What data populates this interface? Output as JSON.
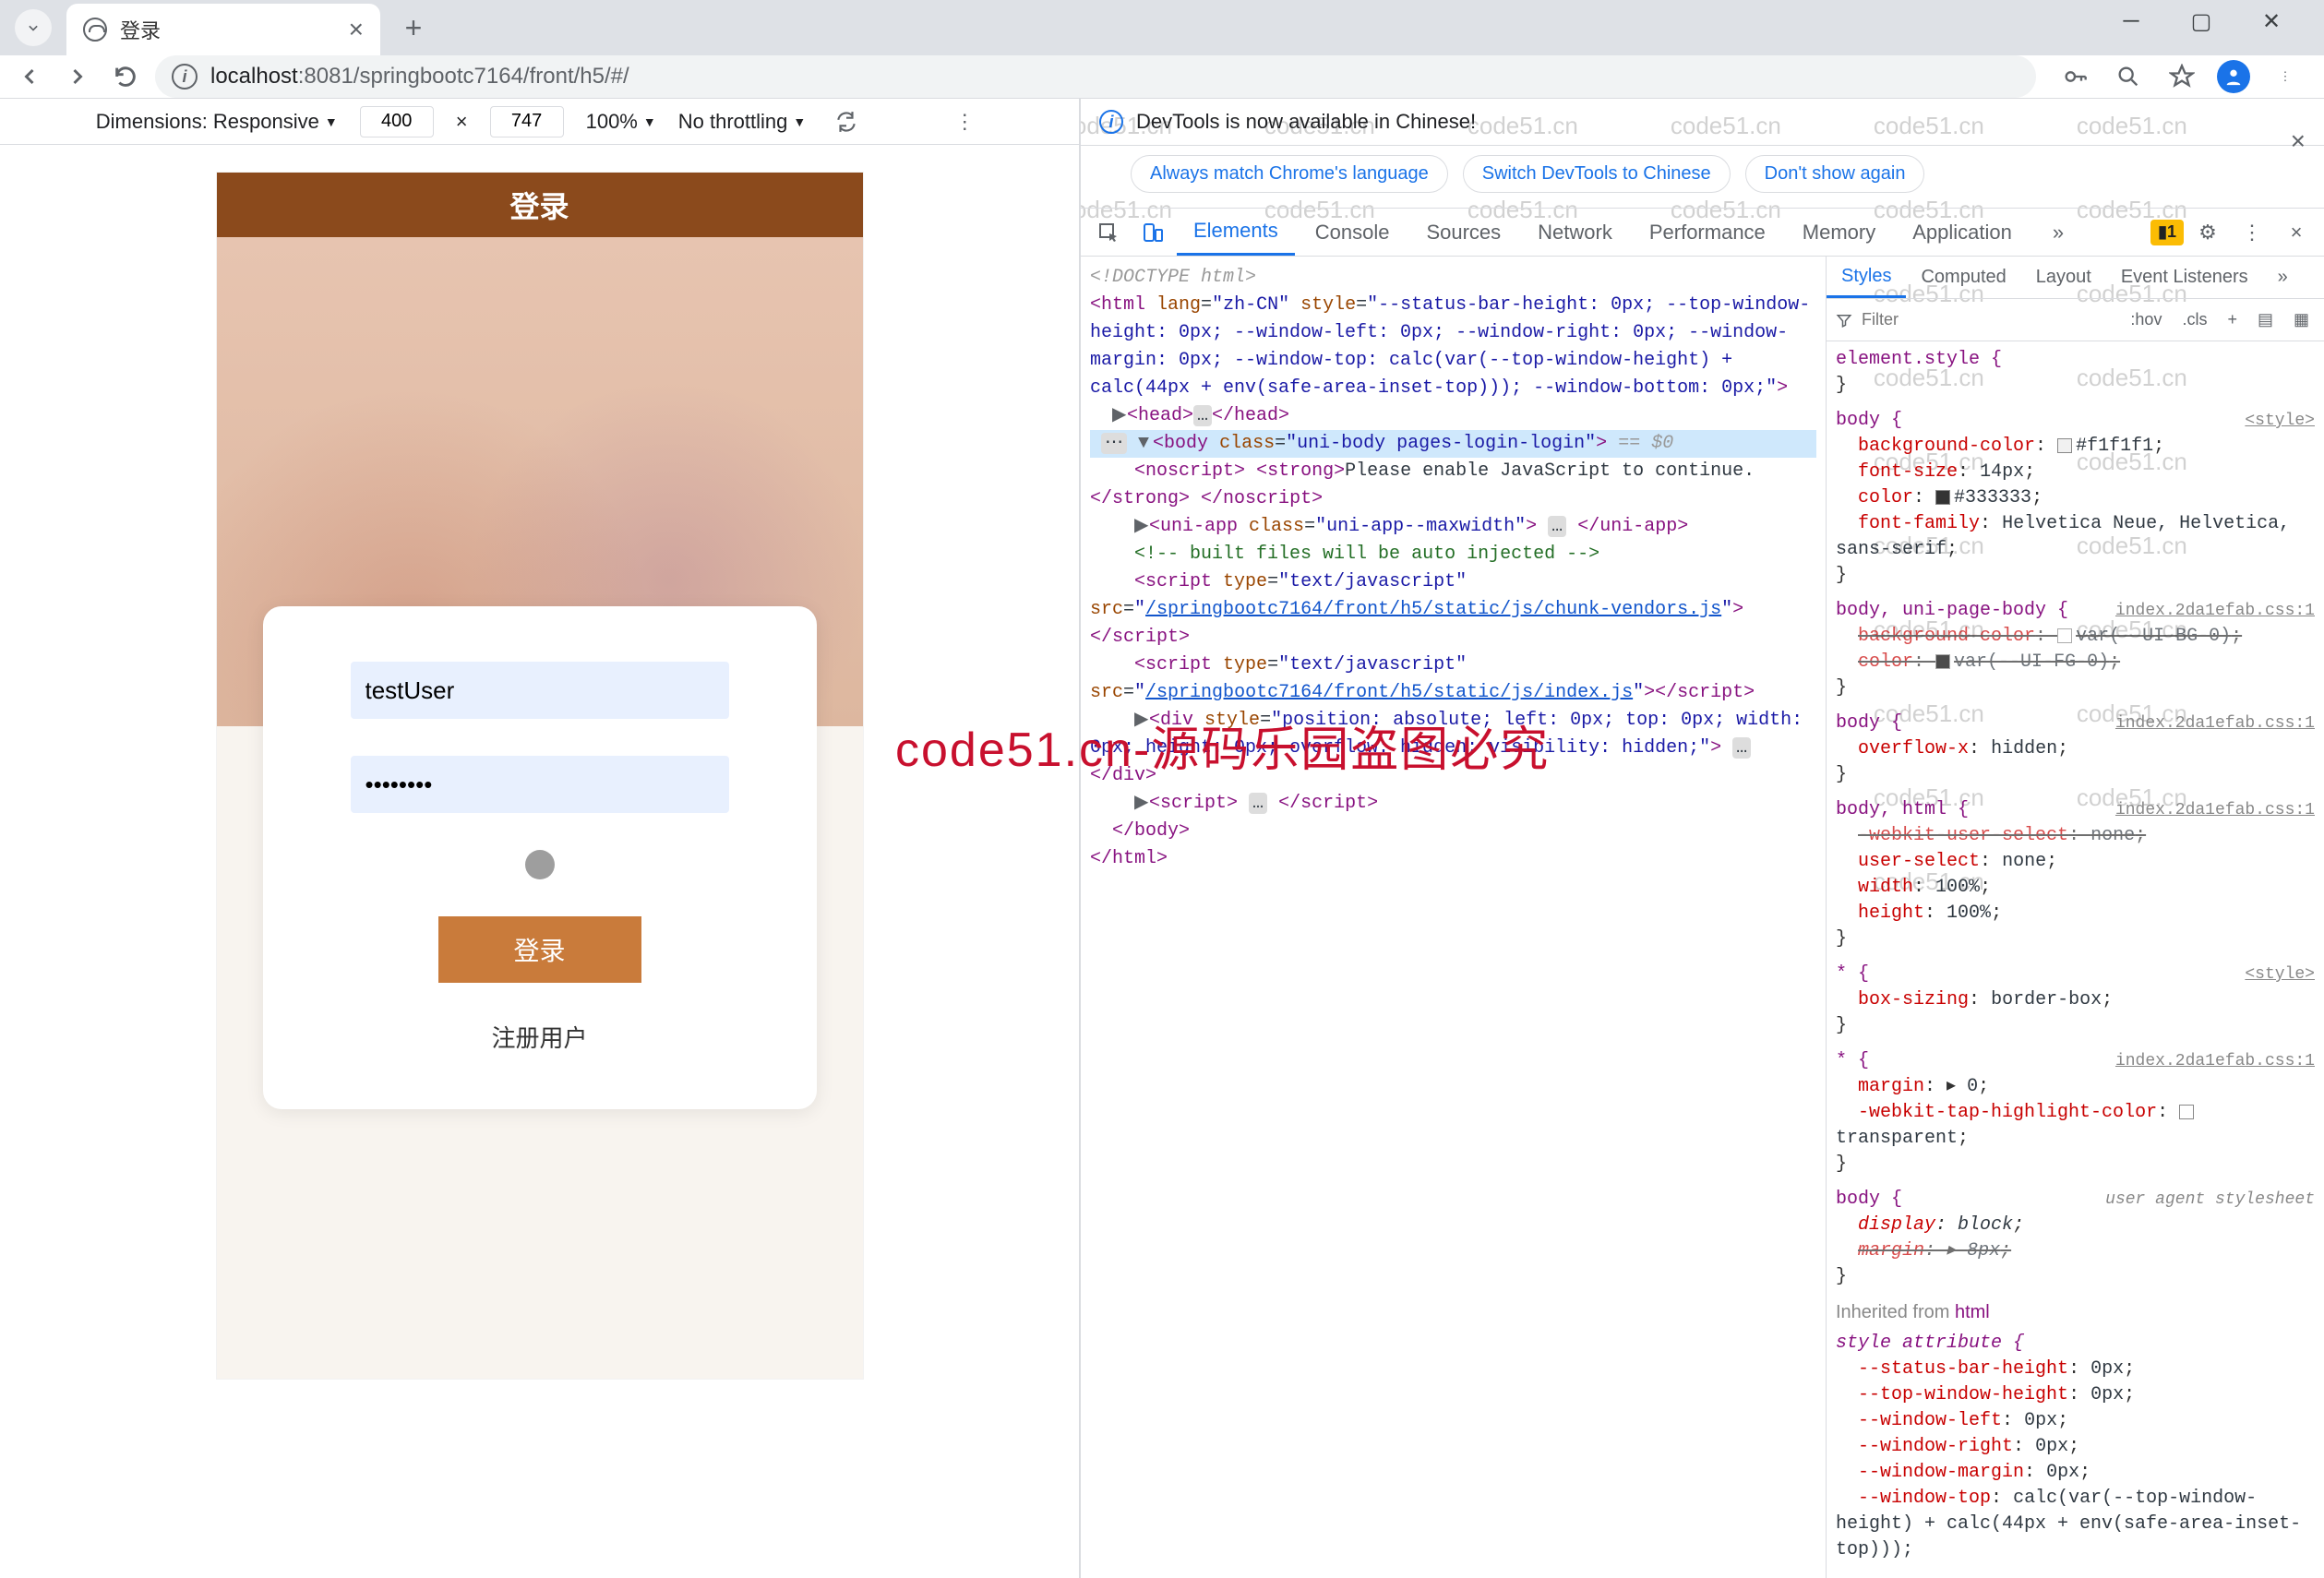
{
  "tab": {
    "title": "登录"
  },
  "addr": {
    "host": "localhost",
    "port": ":8081",
    "path": "/springbootc7164/front/h5/#/"
  },
  "deviceToolbar": {
    "dimensionsLabel": "Dimensions: Responsive",
    "width": "400",
    "x": "×",
    "height": "747",
    "zoom": "100%",
    "throttling": "No throttling"
  },
  "app": {
    "headerTitle": "登录",
    "username": "testUser",
    "password": "••••••••",
    "loginBtn": "登录",
    "registerLink": "注册用户"
  },
  "devtools": {
    "bannerText": "DevTools is now available in Chinese!",
    "pill1": "Always match Chrome's language",
    "pill2": "Switch DevTools to Chinese",
    "pill3": "Don't show again",
    "tabs": {
      "elements": "Elements",
      "console": "Console",
      "sources": "Sources",
      "network": "Network",
      "performance": "Performance",
      "memory": "Memory",
      "application": "Application"
    },
    "warnCount": "1"
  },
  "tree": {
    "doctype": "<!DOCTYPE html>",
    "htmlOpen": "<html lang=\"zh-CN\" style=\"--status-bar-height: 0px; --top-window-height: 0px; --window-left: 0px; --window-right: 0px; --window-margin: 0px; --window-top: calc(var(--top-window-height) + calc(44px + env(safe-area-inset-top))); --window-bottom: 0px;\">",
    "headLine": "<head>…</head>",
    "bodyOpen": "<body class=\"uni-body pages-login-login\"> == $0",
    "noscript1": "<noscript> <strong>Please enable JavaScript to continue.</strong> </noscript>",
    "uniapp": "<uni-app class=\"uni-app--maxwidth\"> … </uni-app>",
    "comment": "<!-- built files will be auto injected -->",
    "script1a": "<script type=\"text/javascript\" src=\"",
    "script1link": "/springbootc7164/front/h5/static/js/chunk-vendors.js",
    "script1b": "\"></​script>",
    "script2a": "<script type=\"text/javascript\" src=\"",
    "script2link": "/springbootc7164/front/h5/static/js/index.js",
    "script2b": "\"></​script>",
    "divLine": "<div style=\"position: absolute; left: 0px; top: 0px; width: 0px; height: 0px; overflow: hidden; visibility: hidden;\"> … </div>",
    "scriptGeneric": "<script> … </​script>",
    "bodyClose": "</body>",
    "htmlClose": "</html>"
  },
  "stylesPanel": {
    "tabs": {
      "styles": "Styles",
      "computed": "Computed",
      "layout": "Layout",
      "evlisteners": "Event Listeners"
    },
    "filterPlaceholder": "Filter",
    "hov": ":hov",
    "cls": ".cls",
    "elementStyle": "element.style {",
    "rule1Sel": "body {",
    "rule1Src": "<style>",
    "r1p1n": "background-color",
    "r1p1v": "#f1f1f1",
    "r1p2n": "font-size",
    "r1p2v": "14px",
    "r1p3n": "color",
    "r1p3v": "#333333",
    "r1p4n": "font-family",
    "r1p4v": "Helvetica Neue, Helvetica, sans-serif",
    "rule2Sel": "body, uni-page-body {",
    "rule2Src": "index.2da1efab.css:1",
    "r2p1n": "background-color",
    "r2p1v": "var(--UI-BG-0)",
    "r2p2n": "color",
    "r2p2v": "var(--UI-FG-0)",
    "rule3Sel": "body {",
    "rule3Src": "index.2da1efab.css:1",
    "r3p1n": "overflow-x",
    "r3p1v": "hidden",
    "rule4Sel": "body, html {",
    "rule4Src": "index.2da1efab.css:1",
    "r4p1n": "-webkit-user-select",
    "r4p1v": "none",
    "r4p2n": "user-select",
    "r4p2v": "none",
    "r4p3n": "width",
    "r4p3v": "100%",
    "r4p4n": "height",
    "r4p4v": "100%",
    "rule5Sel": "* {",
    "rule5Src": "<style>",
    "r5p1n": "box-sizing",
    "r5p1v": "border-box",
    "rule6Sel": "* {",
    "rule6Src": "index.2da1efab.css:1",
    "r6p1n": "margin",
    "r6p1v": "0",
    "r6p2n": "-webkit-tap-highlight-color",
    "r6p2v": "transparent",
    "rule7Sel": "body {",
    "rule7Src": "user agent stylesheet",
    "r7p1n": "display",
    "r7p1v": "block",
    "r7p2n": "margin",
    "r7p2v": "8px",
    "inhLabel": "Inherited from ",
    "inhHtml": "html",
    "rule8Sel": "style attribute {",
    "r8p1n": "--status-bar-height",
    "r8p1v": "0px",
    "r8p2n": "--top-window-height",
    "r8p2v": "0px",
    "r8p3n": "--window-left",
    "r8p3v": "0px",
    "r8p4n": "--window-right",
    "r8p4v": "0px",
    "r8p5n": "--window-margin",
    "r8p5v": "0px",
    "r8p6n": "--window-top",
    "r8p6v": "calc(var(--top-window-height) + calc(44px + env(safe-area-inset-top)));"
  },
  "watermarkText": "code51.cn",
  "bigWatermark": "code51.cn-源码乐园盗图必究"
}
